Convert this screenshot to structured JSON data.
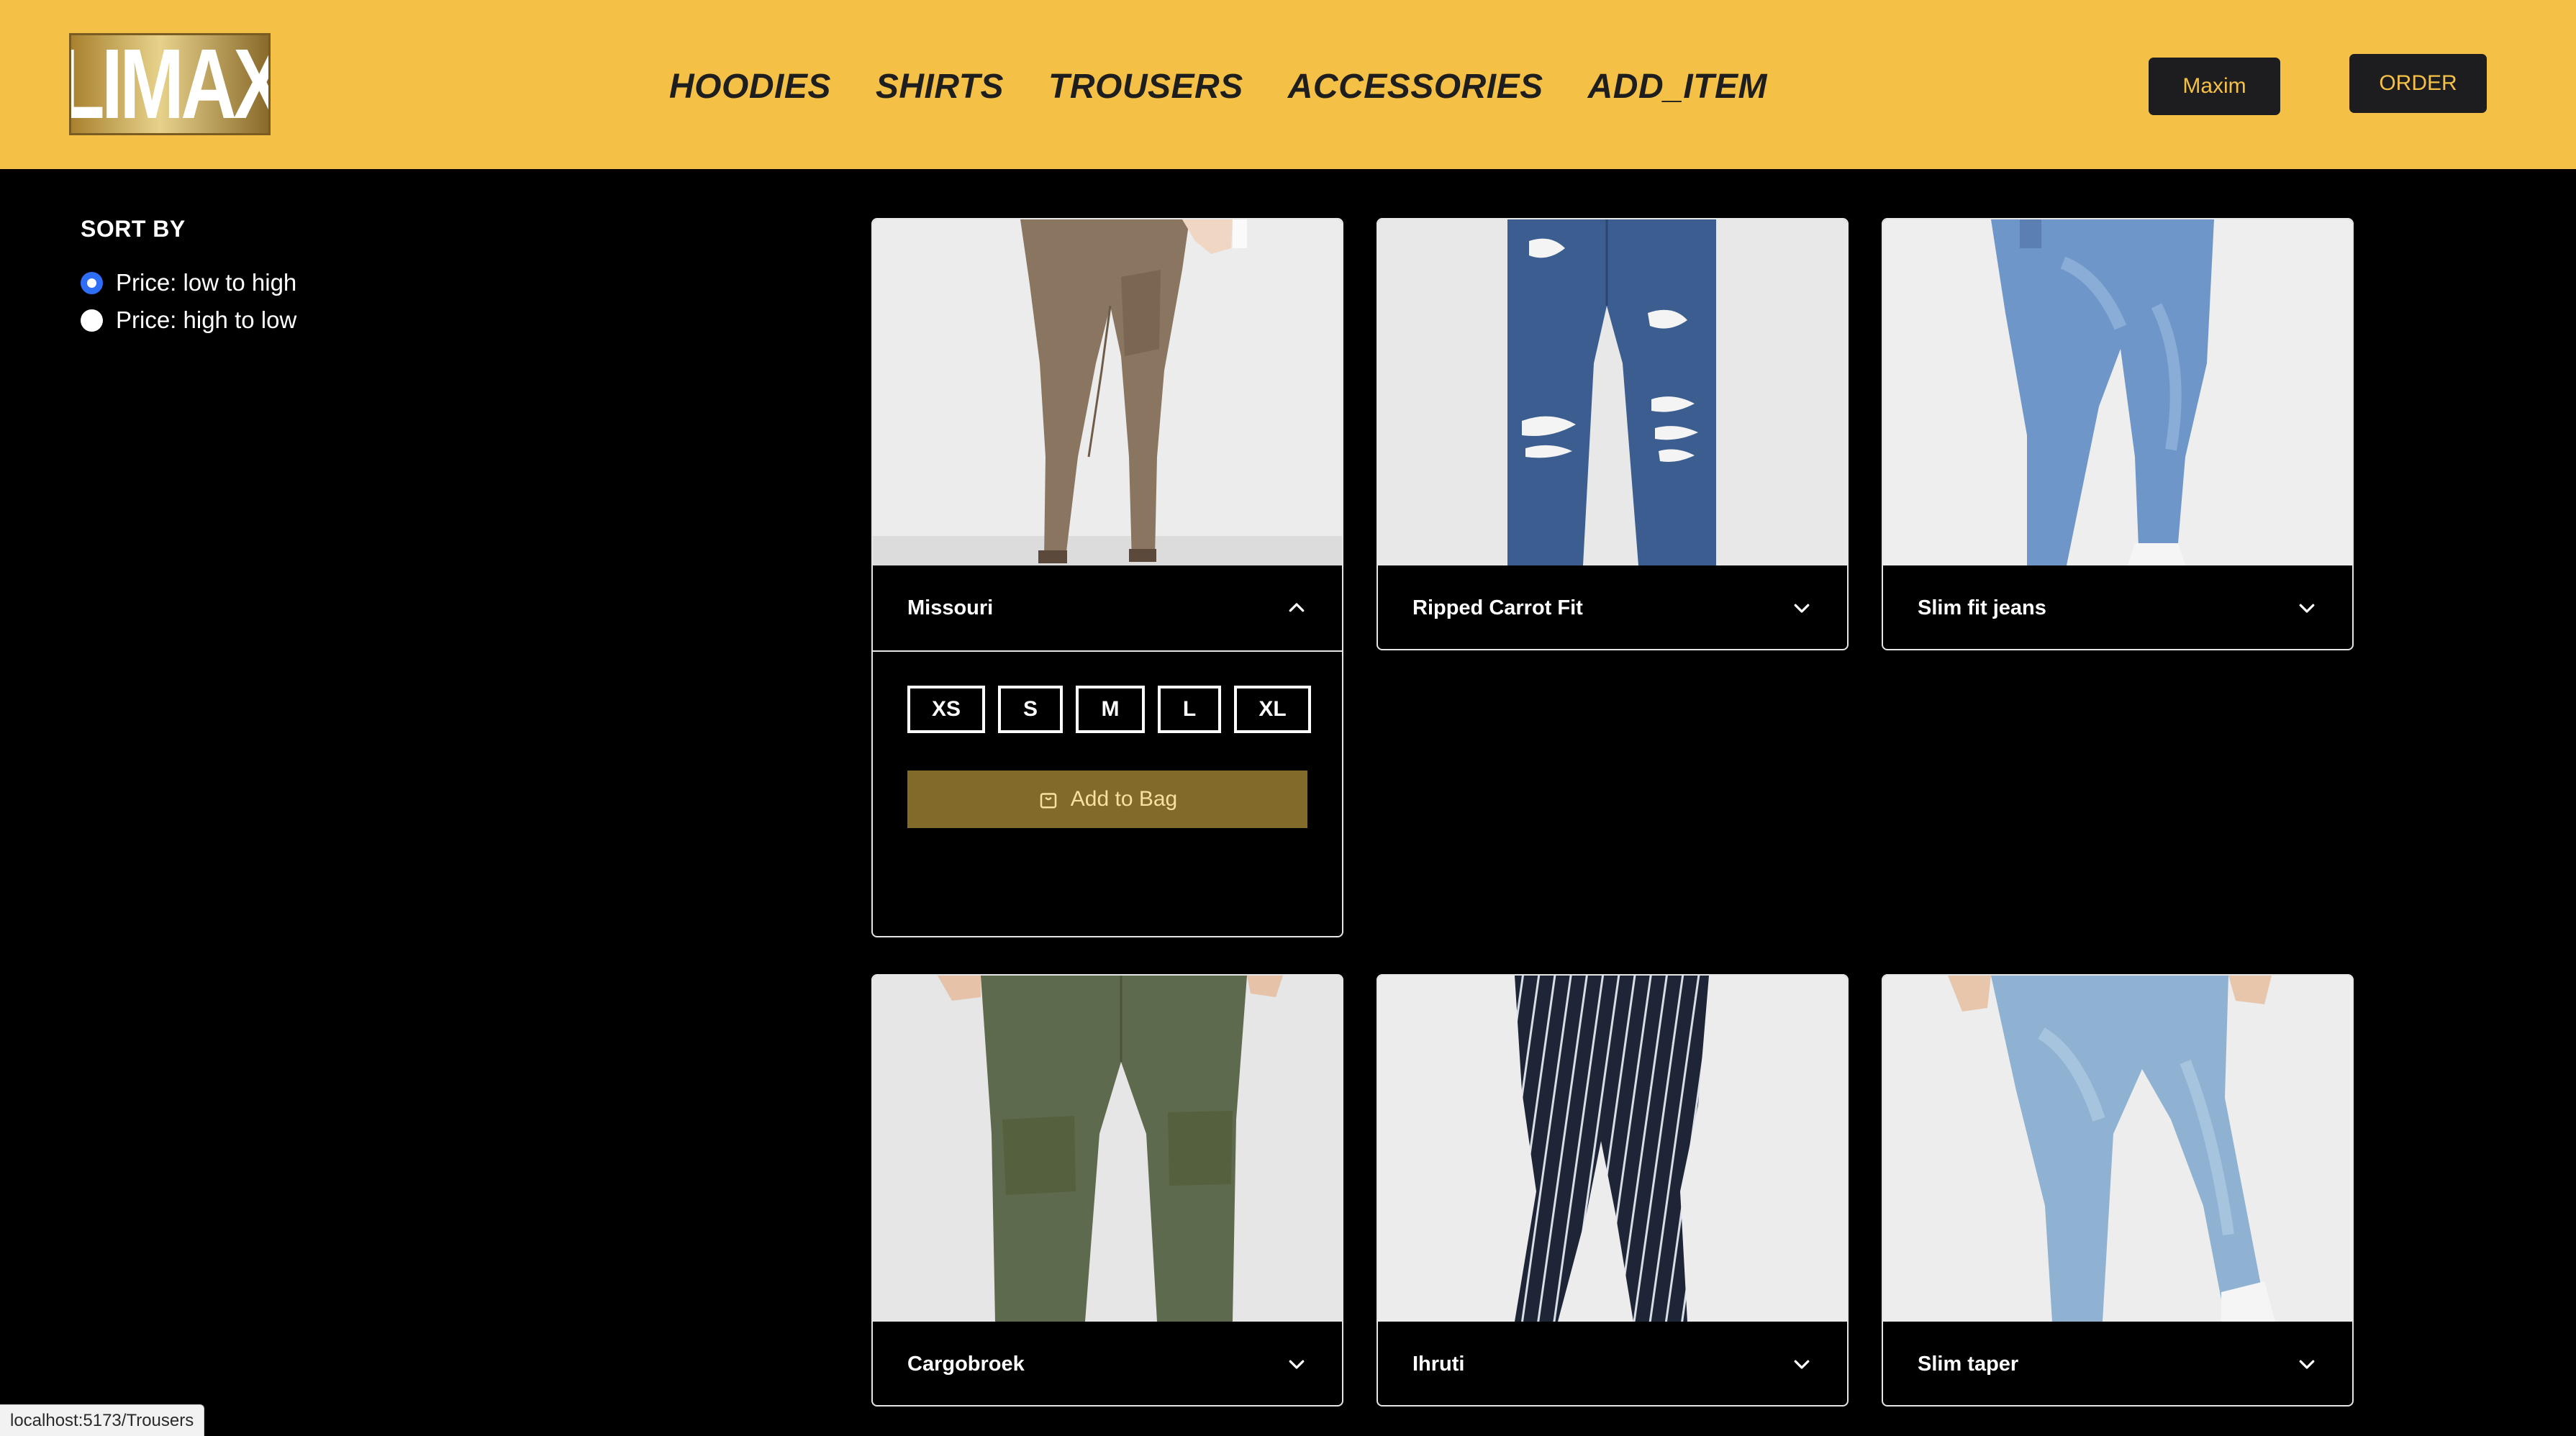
{
  "brand": {
    "logo_text": "LIMAX"
  },
  "nav": {
    "items": [
      {
        "label": "HOODIES"
      },
      {
        "label": "SHIRTS"
      },
      {
        "label": "TROUSERS"
      },
      {
        "label": "ACCESSORIES"
      },
      {
        "label": "ADD_ITEM"
      }
    ]
  },
  "header": {
    "user_button": "Maxim",
    "order_button": "ORDER"
  },
  "sidebar": {
    "title": "SORT BY",
    "options": [
      {
        "label": "Price: low to high",
        "checked": true
      },
      {
        "label": "Price: high to low",
        "checked": false
      }
    ]
  },
  "products": [
    {
      "name": "Missouri",
      "expanded": true,
      "chevron": "chevron-up-icon"
    },
    {
      "name": "Ripped Carrot Fit",
      "expanded": false,
      "chevron": "chevron-down-icon"
    },
    {
      "name": "Slim fit jeans",
      "expanded": false,
      "chevron": "chevron-down-icon"
    },
    {
      "name": "Cargobroek",
      "expanded": false,
      "chevron": "chevron-down-icon"
    },
    {
      "name": "Ihruti",
      "expanded": false,
      "chevron": "chevron-down-icon"
    },
    {
      "name": "Slim taper",
      "expanded": false,
      "chevron": "chevron-down-icon"
    }
  ],
  "expanded_panel": {
    "sizes": [
      "XS",
      "S",
      "M",
      "L",
      "XL"
    ],
    "add_to_bag": "Add to Bag"
  },
  "status_bar": {
    "url": "localhost:5173/Trousers"
  },
  "colors": {
    "header_bg": "#f4c146",
    "page_bg": "#000000",
    "button_dark": "#1d1d1f",
    "add_to_bag_bg": "#826a2a",
    "radio_checked": "#2f6df6"
  }
}
